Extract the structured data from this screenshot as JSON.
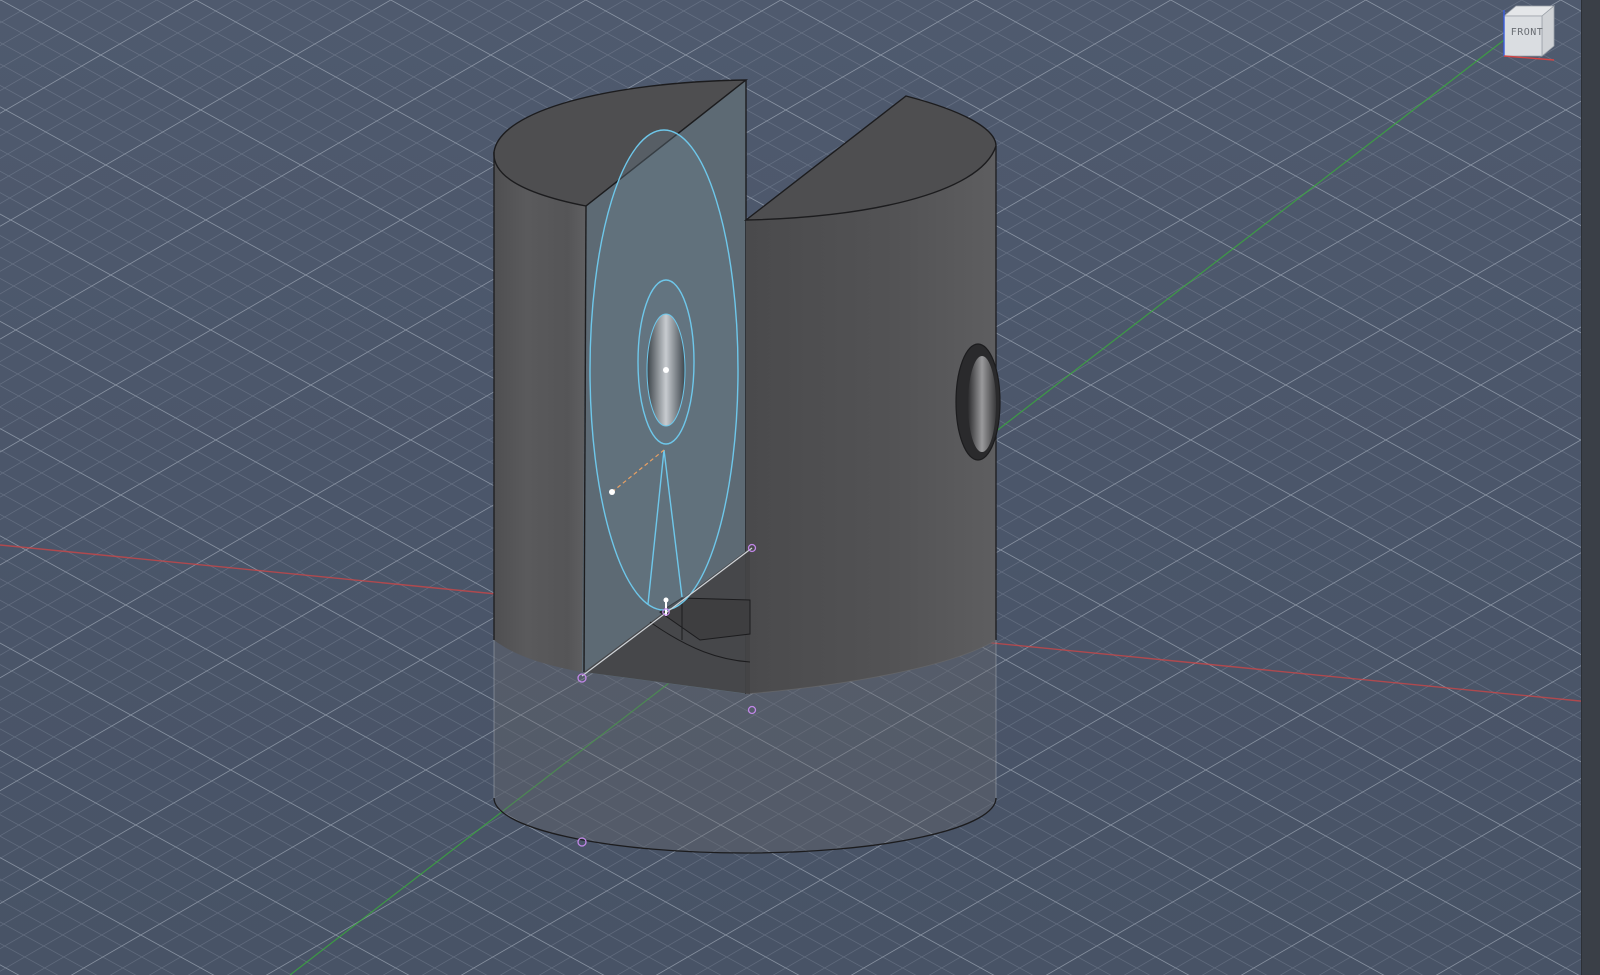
{
  "viewport": {
    "background": "#4d586c",
    "grid_color": "#c9d2dd",
    "axes": {
      "x_color": "#d24545",
      "y_color": "#38b238"
    }
  },
  "model": {
    "body_color": "#555557",
    "selected_face_color": "#5d6a74",
    "selection_edge_color": "#6ec7ea",
    "construction_point_color": "#c187e8",
    "dimension_line_color": "#e8a063"
  },
  "viewcube": {
    "face_label": "FRONT"
  }
}
